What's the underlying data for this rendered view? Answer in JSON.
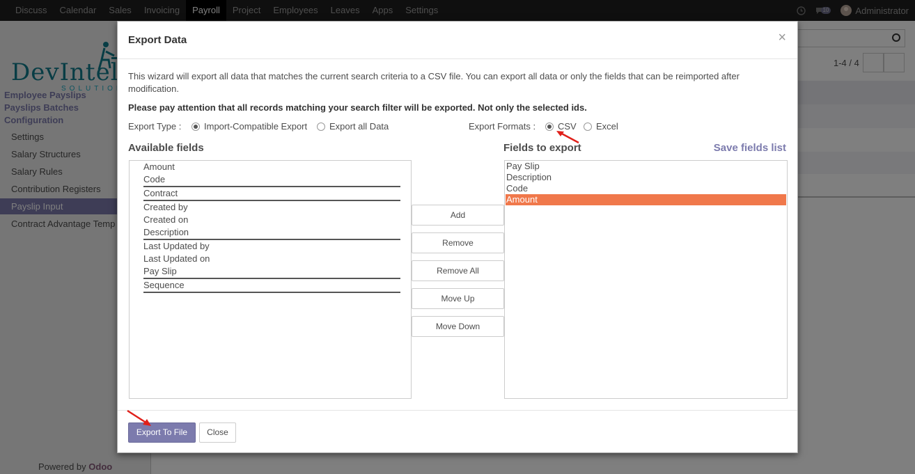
{
  "navbar": {
    "items": [
      "Discuss",
      "Calendar",
      "Sales",
      "Invoicing",
      "Payroll",
      "Project",
      "Employees",
      "Leaves",
      "Apps",
      "Settings"
    ],
    "active_item": "Payroll",
    "messages_badge": "10",
    "user_name": "Administrator"
  },
  "sidebar": {
    "logo_text": "DevIntel",
    "logo_subtext": "SOLUTIONS",
    "categories": [
      "Employee Payslips",
      "Payslips Batches",
      "Configuration"
    ],
    "items": [
      "Settings",
      "Salary Structures",
      "Salary Rules",
      "Contribution Registers",
      "Payslip Input",
      "Contract Advantage Temp"
    ],
    "active_item": "Payslip Input",
    "powered_prefix": "Powered by",
    "powered_brand": "Odoo"
  },
  "background": {
    "pager": "1-4 / 4"
  },
  "modal": {
    "title": "Export Data",
    "close_glyph": "×",
    "intro": "This wizard will export all data that matches the current search criteria to a CSV file. You can export all data or only the fields that can be reimported after modification.",
    "warning": "Please pay attention that all records matching your search filter will be exported. Not only the selected ids.",
    "export_type": {
      "label": "Export Type :",
      "options": [
        "Import-Compatible Export",
        "Export all Data"
      ],
      "selected": "Import-Compatible Export"
    },
    "export_formats": {
      "label": "Export Formats :",
      "options": [
        "CSV",
        "Excel"
      ],
      "selected": "CSV"
    },
    "available_fields": {
      "title": "Available fields",
      "items": [
        "Amount",
        "Code",
        "Contract",
        "Created by",
        "Created on",
        "Description",
        "Last Updated by",
        "Last Updated on",
        "Pay Slip",
        "Sequence"
      ]
    },
    "buttons": {
      "add": "Add",
      "remove": "Remove",
      "remove_all": "Remove All",
      "move_up": "Move Up",
      "move_down": "Move Down"
    },
    "fields_to_export": {
      "title": "Fields to export",
      "save_link": "Save fields list",
      "items": [
        "Pay Slip",
        "Description",
        "Code",
        "Amount"
      ],
      "selected": "Amount"
    },
    "footer": {
      "export_button": "Export To File",
      "close_button": "Close"
    }
  },
  "colors": {
    "brand": "#7c7bad",
    "selected_row": "#f0784b",
    "annotation_arrow": "#e0201a"
  }
}
